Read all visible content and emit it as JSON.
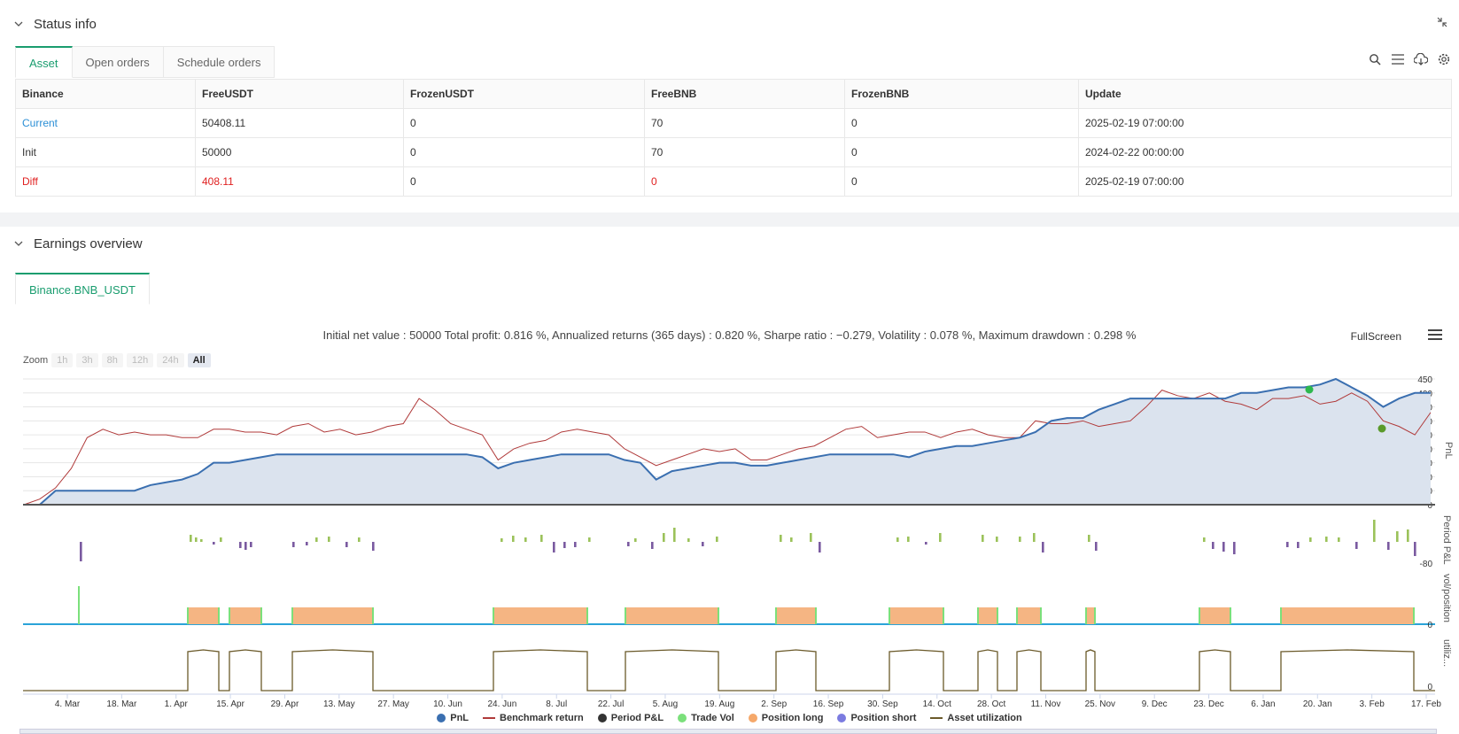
{
  "status": {
    "title": "Status info",
    "tabs": [
      "Asset",
      "Open orders",
      "Schedule orders"
    ],
    "table": {
      "headers": [
        "Binance",
        "FreeUSDT",
        "FrozenUSDT",
        "FreeBNB",
        "FrozenBNB",
        "Update"
      ],
      "rows": [
        [
          "Current",
          "50408.11",
          "0",
          "70",
          "0",
          "2025-02-19 07:00:00"
        ],
        [
          "Init",
          "50000",
          "0",
          "70",
          "0",
          "2024-02-22 00:00:00"
        ],
        [
          "Diff",
          "408.11",
          "0",
          "0",
          "0",
          "2025-02-19 07:00:00"
        ]
      ]
    }
  },
  "earnings": {
    "title": "Earnings overview",
    "tab": "Binance.BNB_USDT",
    "summary": "Initial net value : 50000 Total profit: 0.816 %, Annualized returns (365 days) : 0.820 %, Sharpe ratio : −0.279, Volatility : 0.078 %, Maximum drawdown : 0.298 %",
    "fullscreen": "FullScreen",
    "zoom_label": "Zoom",
    "zoom_buttons": [
      "1h",
      "3h",
      "8h",
      "12h",
      "24h",
      "All"
    ],
    "legend": [
      "PnL",
      "Benchmark return",
      "Period P&L",
      "Trade Vol",
      "Position long",
      "Position short",
      "Asset utilization"
    ]
  },
  "colors": {
    "accent": "#1a9d6f",
    "pnl": "#3a6fb0",
    "benchmark": "#b03a3a",
    "period_pos": "#9bc25a",
    "period_neg": "#7a5aa0",
    "trade_vol": "#7be07b",
    "position_long": "#f5b583",
    "position_short": "#7b7be0",
    "utilization": "#6b5a2a"
  },
  "chart_data": {
    "type": "line",
    "x_ticks": [
      "4. Mar",
      "18. Mar",
      "1. Apr",
      "15. Apr",
      "29. Apr",
      "13. May",
      "27. May",
      "10. Jun",
      "24. Jun",
      "8. Jul",
      "22. Jul",
      "5. Aug",
      "19. Aug",
      "2. Sep",
      "16. Sep",
      "30. Sep",
      "14. Oct",
      "28. Oct",
      "11. Nov",
      "25. Nov",
      "9. Dec",
      "23. Dec",
      "6. Jan",
      "20. Jan",
      "3. Feb",
      "17. Feb"
    ],
    "pnl_axis": {
      "ylabel": "PnL",
      "ticks": [
        0,
        50,
        100,
        150,
        200,
        250,
        300,
        350,
        400,
        450
      ],
      "ylim": [
        0,
        450
      ]
    },
    "period_axis": {
      "ylabel": "Period P&L",
      "ticks": [
        -80
      ]
    },
    "vol_axis": {
      "ylabel": "vol/position",
      "ticks": [
        0
      ]
    },
    "util_axis": {
      "ylabel": "utiliz...",
      "ticks": [
        0
      ]
    },
    "series": [
      {
        "name": "PnL",
        "values": [
          0,
          0,
          50,
          50,
          50,
          50,
          50,
          50,
          70,
          80,
          90,
          110,
          150,
          150,
          160,
          170,
          180,
          180,
          180,
          180,
          180,
          180,
          180,
          180,
          180,
          180,
          180,
          180,
          180,
          170,
          130,
          150,
          160,
          170,
          180,
          180,
          180,
          180,
          160,
          150,
          90,
          120,
          130,
          140,
          150,
          150,
          140,
          140,
          150,
          160,
          170,
          180,
          180,
          180,
          180,
          180,
          170,
          190,
          200,
          210,
          210,
          220,
          230,
          240,
          260,
          300,
          310,
          310,
          340,
          360,
          380,
          380,
          380,
          380,
          380,
          380,
          380,
          400,
          400,
          410,
          420,
          420,
          430,
          450,
          420,
          390,
          350,
          380,
          400,
          400
        ]
      },
      {
        "name": "Benchmark return",
        "values": [
          0,
          20,
          60,
          130,
          240,
          270,
          250,
          260,
          250,
          250,
          240,
          240,
          270,
          270,
          260,
          260,
          250,
          280,
          290,
          260,
          270,
          250,
          260,
          280,
          290,
          380,
          340,
          290,
          270,
          250,
          160,
          200,
          220,
          230,
          260,
          270,
          260,
          250,
          200,
          170,
          140,
          160,
          180,
          200,
          190,
          200,
          160,
          160,
          180,
          200,
          210,
          240,
          270,
          280,
          240,
          250,
          260,
          260,
          240,
          260,
          270,
          250,
          240,
          240,
          300,
          290,
          290,
          300,
          280,
          290,
          300,
          350,
          410,
          390,
          380,
          400,
          370,
          360,
          340,
          380,
          380,
          390,
          360,
          370,
          400,
          370,
          300,
          280,
          250,
          330
        ]
      }
    ]
  }
}
